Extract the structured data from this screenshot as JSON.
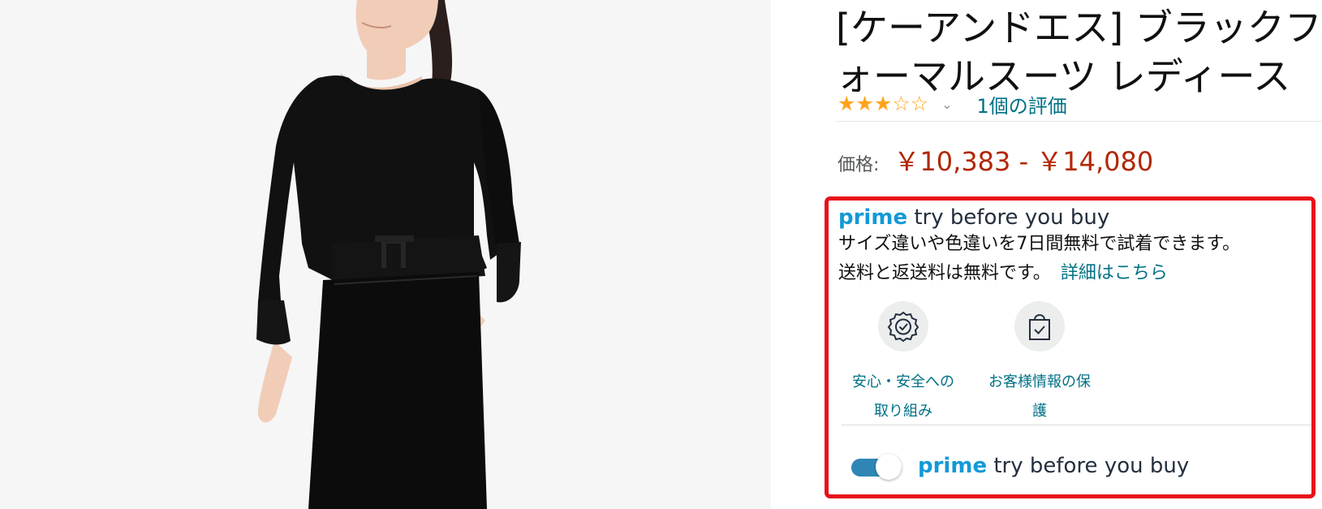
{
  "product": {
    "title_line1": "[ケーアンドエス] ブラックフォ",
    "title_line2": "ォーマルスーツ レディース",
    "rating_value": 3,
    "rating_max": 5,
    "rating_count_link": "1個の評価",
    "price_label": "価格:",
    "price_range": "￥10,383 - ￥14,080"
  },
  "prime": {
    "logo_word": "prime",
    "heading_rest": "try before you buy",
    "desc_line1": "サイズ違いや色違いを7日間無料で試着できます。",
    "desc_line2": "送料と返送料は無料です。",
    "details_link": "詳細はこちら",
    "features": [
      {
        "label_line1": "安心・安全への",
        "label_line2": "取り組み",
        "icon": "shield-badge-icon"
      },
      {
        "label_line1": "お客様情報の保",
        "label_line2": "護",
        "icon": "secure-bag-icon"
      }
    ],
    "toggle_on": true,
    "toggle_logo_word": "prime",
    "toggle_label": "try before you buy"
  },
  "colors": {
    "accent_link": "#007185",
    "price": "#b12704",
    "prime_blue": "#1399d6",
    "highlight_border": "#e8101a",
    "star": "#ffa41c"
  }
}
